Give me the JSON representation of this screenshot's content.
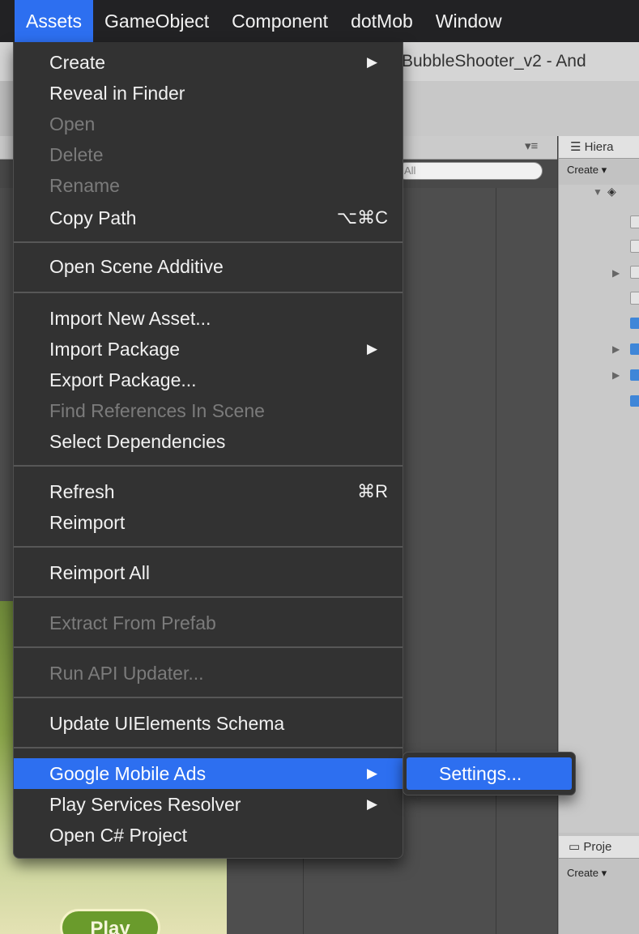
{
  "menubar": {
    "items": [
      "Assets",
      "GameObject",
      "Component",
      "dotMob",
      "Window"
    ],
    "active_index": 0
  },
  "window": {
    "title": "BubbleShooter_v2 - And"
  },
  "scene": {
    "search_placeholder": "All",
    "play_label": "Play"
  },
  "hierarchy": {
    "tab_label": "Hiera",
    "create_label": "Create"
  },
  "project": {
    "tab_label": "Proje",
    "create_label": "Create"
  },
  "assets_menu": {
    "items": [
      {
        "label": "Create",
        "submenu": true,
        "enabled": true
      },
      {
        "label": "Reveal in Finder",
        "enabled": true
      },
      {
        "label": "Open",
        "enabled": false
      },
      {
        "label": "Delete",
        "enabled": false
      },
      {
        "label": "Rename",
        "enabled": false
      },
      {
        "label": "Copy Path",
        "shortcut": "⌥⌘C",
        "enabled": true
      },
      {
        "label": "Open Scene Additive",
        "enabled": true
      },
      {
        "label": "Import New Asset...",
        "enabled": true
      },
      {
        "label": "Import Package",
        "submenu": true,
        "enabled": true
      },
      {
        "label": "Export Package...",
        "enabled": true
      },
      {
        "label": "Find References In Scene",
        "enabled": false
      },
      {
        "label": "Select Dependencies",
        "enabled": true
      },
      {
        "label": "Refresh",
        "shortcut": "⌘R",
        "enabled": true
      },
      {
        "label": "Reimport",
        "enabled": true
      },
      {
        "label": "Reimport All",
        "enabled": true
      },
      {
        "label": "Extract From Prefab",
        "enabled": false
      },
      {
        "label": "Run API Updater...",
        "enabled": false
      },
      {
        "label": "Update UIElements Schema",
        "enabled": true
      },
      {
        "label": "Google Mobile Ads",
        "submenu": true,
        "enabled": true,
        "highlighted": true
      },
      {
        "label": "Play Services Resolver",
        "submenu": true,
        "enabled": true
      },
      {
        "label": "Open C# Project",
        "enabled": true
      }
    ]
  },
  "google_mobile_ads_submenu": {
    "items": [
      {
        "label": "Settings...",
        "highlighted": true
      }
    ]
  },
  "colors": {
    "highlight": "#2d6ff0",
    "menu_bg": "#323232",
    "disabled_text": "#7b7b7b"
  }
}
